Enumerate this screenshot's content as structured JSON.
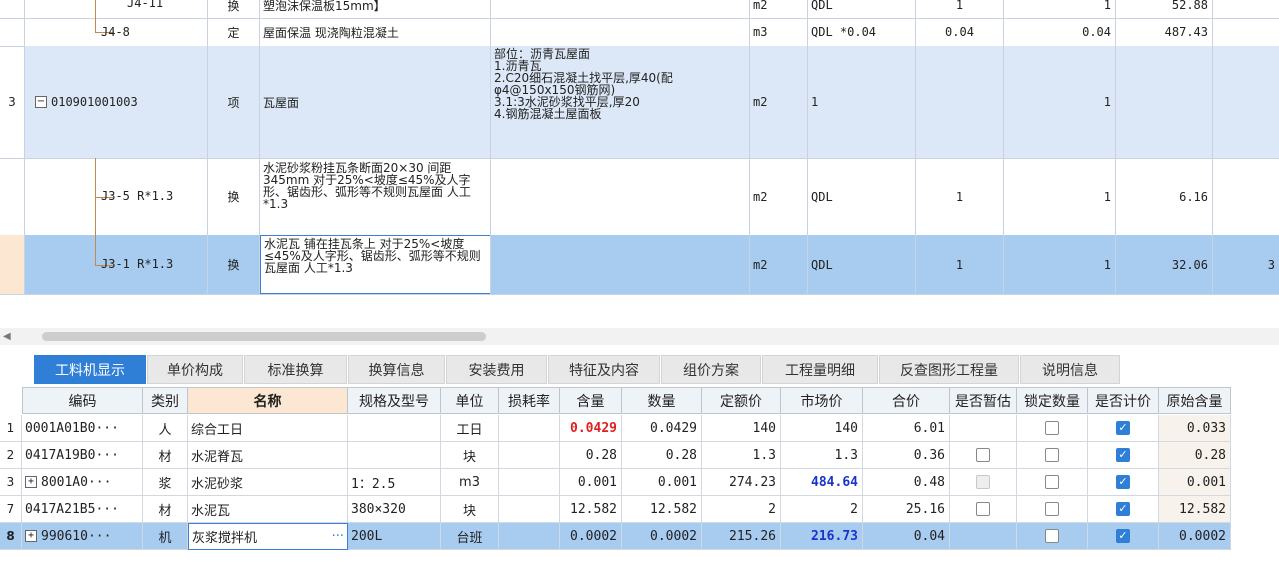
{
  "top_rows": [
    {
      "num": "",
      "code": "J4-11",
      "type": "换",
      "name": "塑泡沫保温板15mm】",
      "desc": "",
      "unit": "m2",
      "expr": "QDL",
      "qty1": "1",
      "qty2": "1",
      "price": "52.88"
    },
    {
      "num": "",
      "code": "J4-8",
      "type": "定",
      "name": "屋面保温 现浇陶粒混凝土",
      "desc": "",
      "unit": "m3",
      "expr": "QDL *0.04",
      "qty1": "0.04",
      "qty2": "0.04",
      "price": "487.43"
    },
    {
      "num": "3",
      "code": "010901001003",
      "type": "项",
      "name": "瓦屋面",
      "desc": "部位：沥青瓦屋面\n1.沥青瓦\n2.C20细石混凝土找平层,厚40(配\nφ4@150x150钢筋网)\n3.1:3水泥砂浆找平层,厚20\n4.钢筋混凝土屋面板",
      "unit": "m2",
      "expr": "1",
      "qty1": "",
      "qty2": "1",
      "price": ""
    },
    {
      "num": "",
      "code": "J3-5 R*1.3",
      "type": "换",
      "name": "水泥砂浆粉挂瓦条断面20×30 间距345mm  对于25%<坡度≤45%及人字形、锯齿形、弧形等不规则瓦屋面 人工*1.3",
      "desc": "",
      "unit": "m2",
      "expr": "QDL",
      "qty1": "1",
      "qty2": "1",
      "price": "6.16"
    },
    {
      "num": "",
      "code": "J3-1 R*1.3",
      "type": "换",
      "name": "水泥瓦 铺在挂瓦条上  对于25%<坡度≤45%及人字形、锯齿形、弧形等不规则瓦屋面 人工*1.3",
      "desc": "",
      "unit": "m2",
      "expr": "QDL",
      "qty1": "1",
      "qty2": "1",
      "price": "32.06",
      "extra": "3"
    }
  ],
  "tabs": [
    "工料机显示",
    "单价构成",
    "标准换算",
    "换算信息",
    "安装费用",
    "特征及内容",
    "组价方案",
    "工程量明细",
    "反查图形工程量",
    "说明信息"
  ],
  "columns": [
    "编码",
    "类别",
    "名称",
    "规格及型号",
    "单位",
    "损耗率",
    "含量",
    "数量",
    "定额价",
    "市场价",
    "合价",
    "是否暂估",
    "锁定数量",
    "是否计价",
    "原始含量"
  ],
  "rows": [
    {
      "num": "1",
      "code": "0001A01B0···",
      "cat": "人",
      "name": "综合工日",
      "spec": "",
      "unit": "工日",
      "loss": "",
      "content": "0.0429",
      "qty": "0.0429",
      "quota": "140",
      "market": "140",
      "total": "6.01",
      "est": "none",
      "lock": false,
      "priced": true,
      "orig": "0.033"
    },
    {
      "num": "2",
      "code": "0417A19B0···",
      "cat": "材",
      "name": "水泥脊瓦",
      "spec": "",
      "unit": "块",
      "loss": "",
      "content": "0.28",
      "qty": "0.28",
      "quota": "1.3",
      "market": "1.3",
      "total": "0.36",
      "est": "box",
      "lock": false,
      "priced": true,
      "orig": "0.28"
    },
    {
      "num": "3",
      "code": "8001A0···",
      "cat": "浆",
      "name": "水泥砂浆",
      "spec": "1：2.5",
      "unit": "m3",
      "loss": "",
      "content": "0.001",
      "qty": "0.001",
      "quota": "274.23",
      "market": "484.64",
      "total": "0.48",
      "est": "disabled",
      "lock": false,
      "priced": true,
      "orig": "0.001",
      "expand": true
    },
    {
      "num": "7",
      "code": "0417A21B5···",
      "cat": "材",
      "name": "水泥瓦",
      "spec": "380×320",
      "unit": "块",
      "loss": "",
      "content": "12.582",
      "qty": "12.582",
      "quota": "2",
      "market": "2",
      "total": "25.16",
      "est": "box",
      "lock": false,
      "priced": true,
      "orig": "12.582"
    },
    {
      "num": "8",
      "code": "990610···",
      "cat": "机",
      "name": "灰浆搅拌机",
      "spec": "200L",
      "unit": "台班",
      "loss": "",
      "content": "0.0002",
      "qty": "0.0002",
      "quota": "215.26",
      "market": "216.73",
      "total": "0.04",
      "est": "none",
      "lock": false,
      "priced": true,
      "orig": "0.0002",
      "expand": true,
      "selected": true
    }
  ],
  "ellipsis": "···",
  "check_mark": "✓",
  "icons": {
    "minus": "−",
    "plus": "+",
    "scroll_left": "◀"
  },
  "colors": {
    "accent": "#2f7fd6",
    "selected_row": "#a8cbf0",
    "red": "#e02020",
    "blue": "#1a33cc"
  }
}
